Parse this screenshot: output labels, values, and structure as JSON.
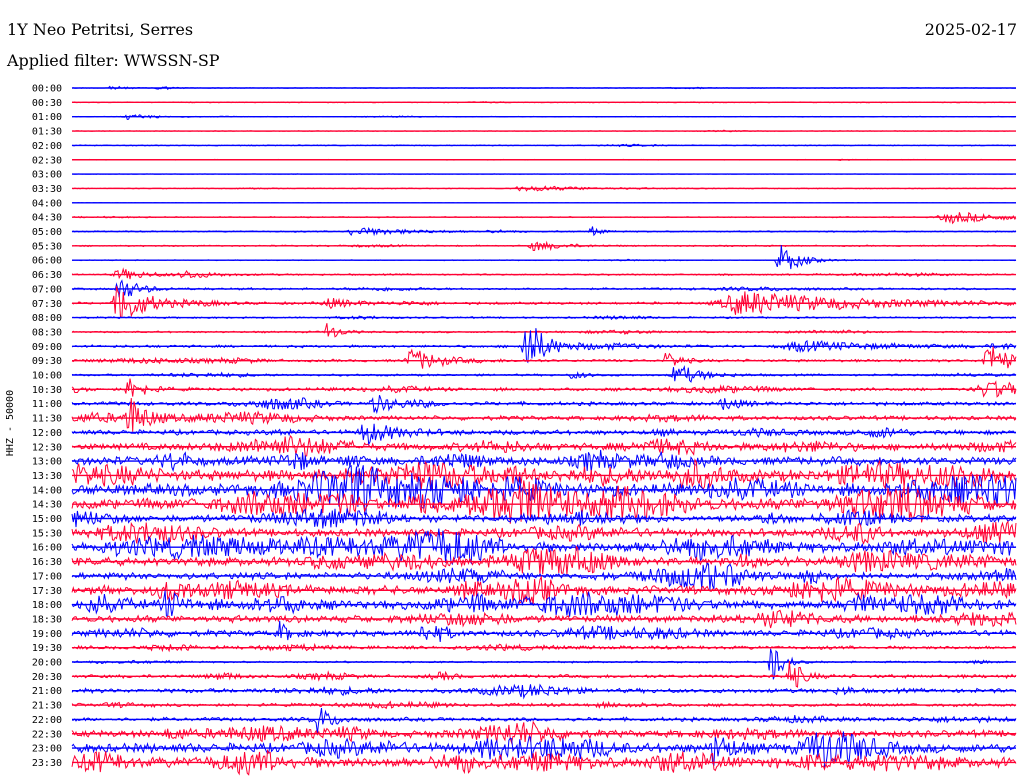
{
  "header": {
    "station": "1Y Neo Petritsi, Serres",
    "date": "2025-02-17",
    "filter": "Applied filter: WWSSN-SP"
  },
  "axis": {
    "ylabel": "HHZ - 50000"
  },
  "chart_data": {
    "type": "line",
    "title": "1Y Neo Petritsi, Serres",
    "subtitle": "Applied filter: WWSSN-SP",
    "date": "2025-02-17",
    "xlabel": "",
    "ylabel": "HHZ - 50000",
    "row_labels": [
      "00:00",
      "00:30",
      "01:00",
      "01:30",
      "02:00",
      "02:30",
      "03:00",
      "03:30",
      "04:00",
      "04:30",
      "05:00",
      "05:30",
      "06:00",
      "06:30",
      "07:00",
      "07:30",
      "08:00",
      "08:30",
      "09:00",
      "09:30",
      "10:00",
      "10:30",
      "11:00",
      "11:30",
      "12:00",
      "12:30",
      "13:00",
      "13:30",
      "14:00",
      "14:30",
      "15:00",
      "15:30",
      "16:00",
      "16:30",
      "17:00",
      "17:30",
      "18:00",
      "18:30",
      "19:00",
      "19:30",
      "20:00",
      "20:30",
      "21:00",
      "21:30",
      "22:00",
      "22:30",
      "23:00",
      "23:30"
    ],
    "trace_colors": [
      "#0000ff",
      "#ff0033"
    ],
    "noise_level": [
      0.4,
      0.5,
      0.4,
      0.4,
      0.6,
      0.4,
      0.3,
      0.5,
      0.3,
      0.6,
      0.8,
      0.8,
      0.5,
      0.9,
      1.2,
      1.5,
      1.0,
      1.0,
      1.5,
      1.5,
      1.2,
      1.8,
      2.2,
      2.5,
      2.8,
      4.0,
      5.0,
      6.5,
      7.0,
      6.5,
      4.0,
      4.5,
      6.0,
      5.0,
      4.0,
      5.0,
      5.5,
      4.0,
      3.5,
      2.0,
      1.0,
      2.0,
      2.5,
      1.8,
      2.2,
      4.0,
      5.5,
      6.0
    ],
    "events": [
      {
        "row": 0,
        "pos": 0.04,
        "amp": 3,
        "width": 0.004
      },
      {
        "row": 0,
        "pos": 0.09,
        "amp": 3,
        "width": 0.004
      },
      {
        "row": 2,
        "pos": 0.06,
        "amp": 3,
        "width": 0.01
      },
      {
        "row": 7,
        "pos": 0.48,
        "amp": 3,
        "width": 0.02
      },
      {
        "row": 9,
        "pos": 0.93,
        "amp": 6,
        "width": 0.02
      },
      {
        "row": 10,
        "pos": 0.3,
        "amp": 4,
        "width": 0.02
      },
      {
        "row": 10,
        "pos": 0.55,
        "amp": 5,
        "width": 0.003
      },
      {
        "row": 11,
        "pos": 0.49,
        "amp": 5,
        "width": 0.01
      },
      {
        "row": 12,
        "pos": 0.75,
        "amp": 18,
        "width": 0.006
      },
      {
        "row": 13,
        "pos": 0.05,
        "amp": 6,
        "width": 0.01
      },
      {
        "row": 13,
        "pos": 0.12,
        "amp": 4,
        "width": 0.01
      },
      {
        "row": 14,
        "pos": 0.05,
        "amp": 14,
        "width": 0.006
      },
      {
        "row": 15,
        "pos": 0.05,
        "amp": 22,
        "width": 0.01
      },
      {
        "row": 15,
        "pos": 0.27,
        "amp": 5,
        "width": 0.01
      },
      {
        "row": 15,
        "pos": 0.71,
        "amp": 12,
        "width": 0.04
      },
      {
        "row": 17,
        "pos": 0.27,
        "amp": 10,
        "width": 0.004
      },
      {
        "row": 18,
        "pos": 0.48,
        "amp": 34,
        "width": 0.006
      },
      {
        "row": 18,
        "pos": 0.77,
        "amp": 5,
        "width": 0.03
      },
      {
        "row": 19,
        "pos": 0.36,
        "amp": 12,
        "width": 0.01
      },
      {
        "row": 19,
        "pos": 0.63,
        "amp": 11,
        "width": 0.004
      },
      {
        "row": 19,
        "pos": 0.97,
        "amp": 18,
        "width": 0.008
      },
      {
        "row": 20,
        "pos": 0.64,
        "amp": 12,
        "width": 0.008
      },
      {
        "row": 20,
        "pos": 0.53,
        "amp": 4,
        "width": 0.005
      },
      {
        "row": 21,
        "pos": 0.06,
        "amp": 14,
        "width": 0.005
      },
      {
        "row": 21,
        "pos": 0.97,
        "amp": 8,
        "width": 0.02
      },
      {
        "row": 22,
        "pos": 0.32,
        "amp": 9,
        "width": 0.008
      },
      {
        "row": 22,
        "pos": 0.69,
        "amp": 8,
        "width": 0.005
      },
      {
        "row": 23,
        "pos": 0.06,
        "amp": 22,
        "width": 0.006
      },
      {
        "row": 24,
        "pos": 0.31,
        "amp": 12,
        "width": 0.01
      },
      {
        "row": 36,
        "pos": 0.02,
        "amp": 14,
        "width": 0.006
      },
      {
        "row": 36,
        "pos": 0.1,
        "amp": 12,
        "width": 0.006
      },
      {
        "row": 38,
        "pos": 0.22,
        "amp": 10,
        "width": 0.004
      },
      {
        "row": 38,
        "pos": 0.37,
        "amp": 9,
        "width": 0.003
      },
      {
        "row": 40,
        "pos": 0.74,
        "amp": 22,
        "width": 0.004
      },
      {
        "row": 41,
        "pos": 0.76,
        "amp": 20,
        "width": 0.004
      },
      {
        "row": 44,
        "pos": 0.26,
        "amp": 14,
        "width": 0.004
      },
      {
        "row": 46,
        "pos": 0.68,
        "amp": 16,
        "width": 0.006
      }
    ]
  }
}
